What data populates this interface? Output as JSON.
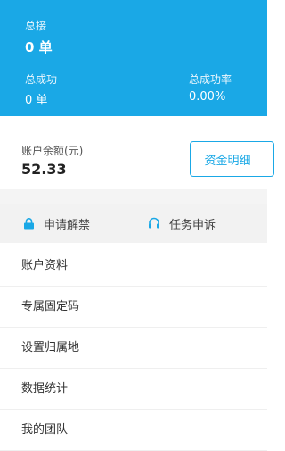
{
  "header": {
    "total_orders_label": "总接",
    "total_orders_value": "0 单",
    "total_success_label": "总成功",
    "total_success_value": "0 单",
    "success_rate_label": "总成功率",
    "success_rate_value": "0.00%"
  },
  "balance": {
    "label": "账户余额(元)",
    "value": "52.33",
    "detail_button": "资金明细"
  },
  "actions": {
    "unban_label": "申请解禁",
    "unban_icon": "lock-icon",
    "appeal_label": "任务申诉",
    "appeal_icon": "headset-icon"
  },
  "menu": {
    "items": [
      {
        "label": "账户资料"
      },
      {
        "label": "专属固定码"
      },
      {
        "label": "设置归属地"
      },
      {
        "label": "数据统计"
      },
      {
        "label": "我的团队"
      }
    ]
  },
  "colors": {
    "accent": "#1aa8e6",
    "divider_bg": "#f2f2f2"
  }
}
